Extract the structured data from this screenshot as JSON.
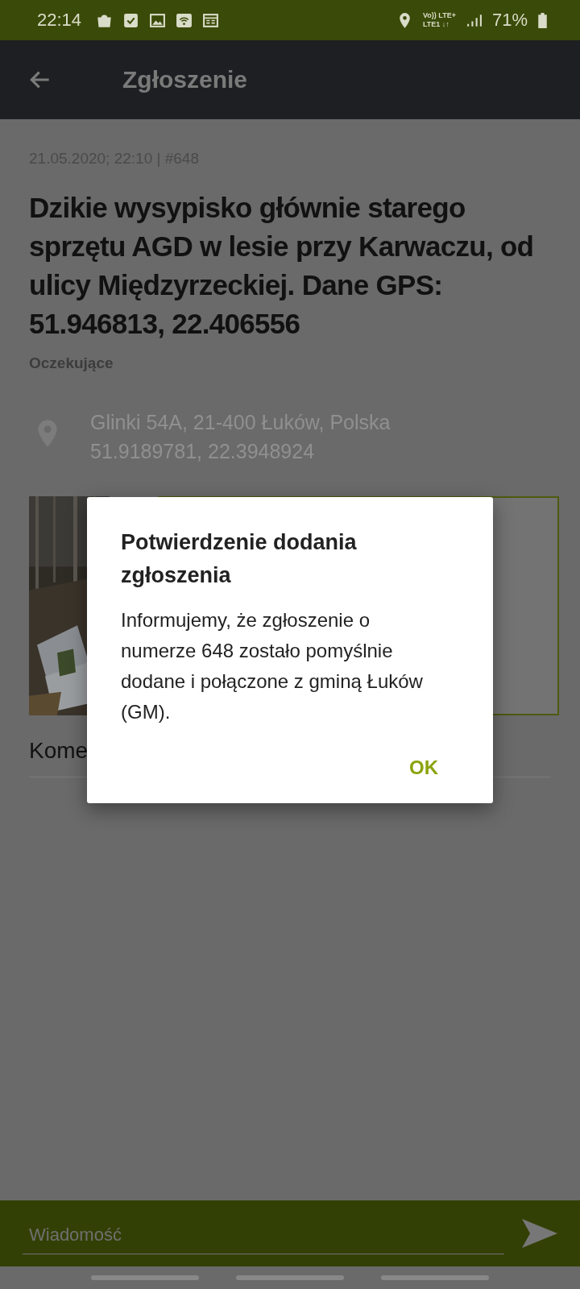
{
  "status_bar": {
    "time": "22:14",
    "network_top": "Vo)) LTE+",
    "network_bottom": "LTE1 ↓↑",
    "battery": "71%"
  },
  "toolbar": {
    "title": "Zgłoszenie"
  },
  "report": {
    "meta": "21.05.2020; 22:10 | #648",
    "title": "Dzikie wysypisko głównie starego sprzętu AGD w lesie przy Karwaczu, od ulicy Międzyrzeckiej. Dane GPS: 51.946813, 22.406556",
    "status": "Oczekujące",
    "address": "Glinki 54A, 21-400 Łuków, Polska",
    "coordinates": "51.9189781, 22.3948924",
    "comments_label": "Kome"
  },
  "message_bar": {
    "placeholder": "Wiadomość"
  },
  "dialog": {
    "title": "Potwierdzenie dodania zgłoszenia",
    "body": "Informujemy, że zgłoszenie o numerze 648 zostało pomyślnie dodane i połączone z gminą Łuków (GM).",
    "buttons": [
      "OK"
    ]
  }
}
